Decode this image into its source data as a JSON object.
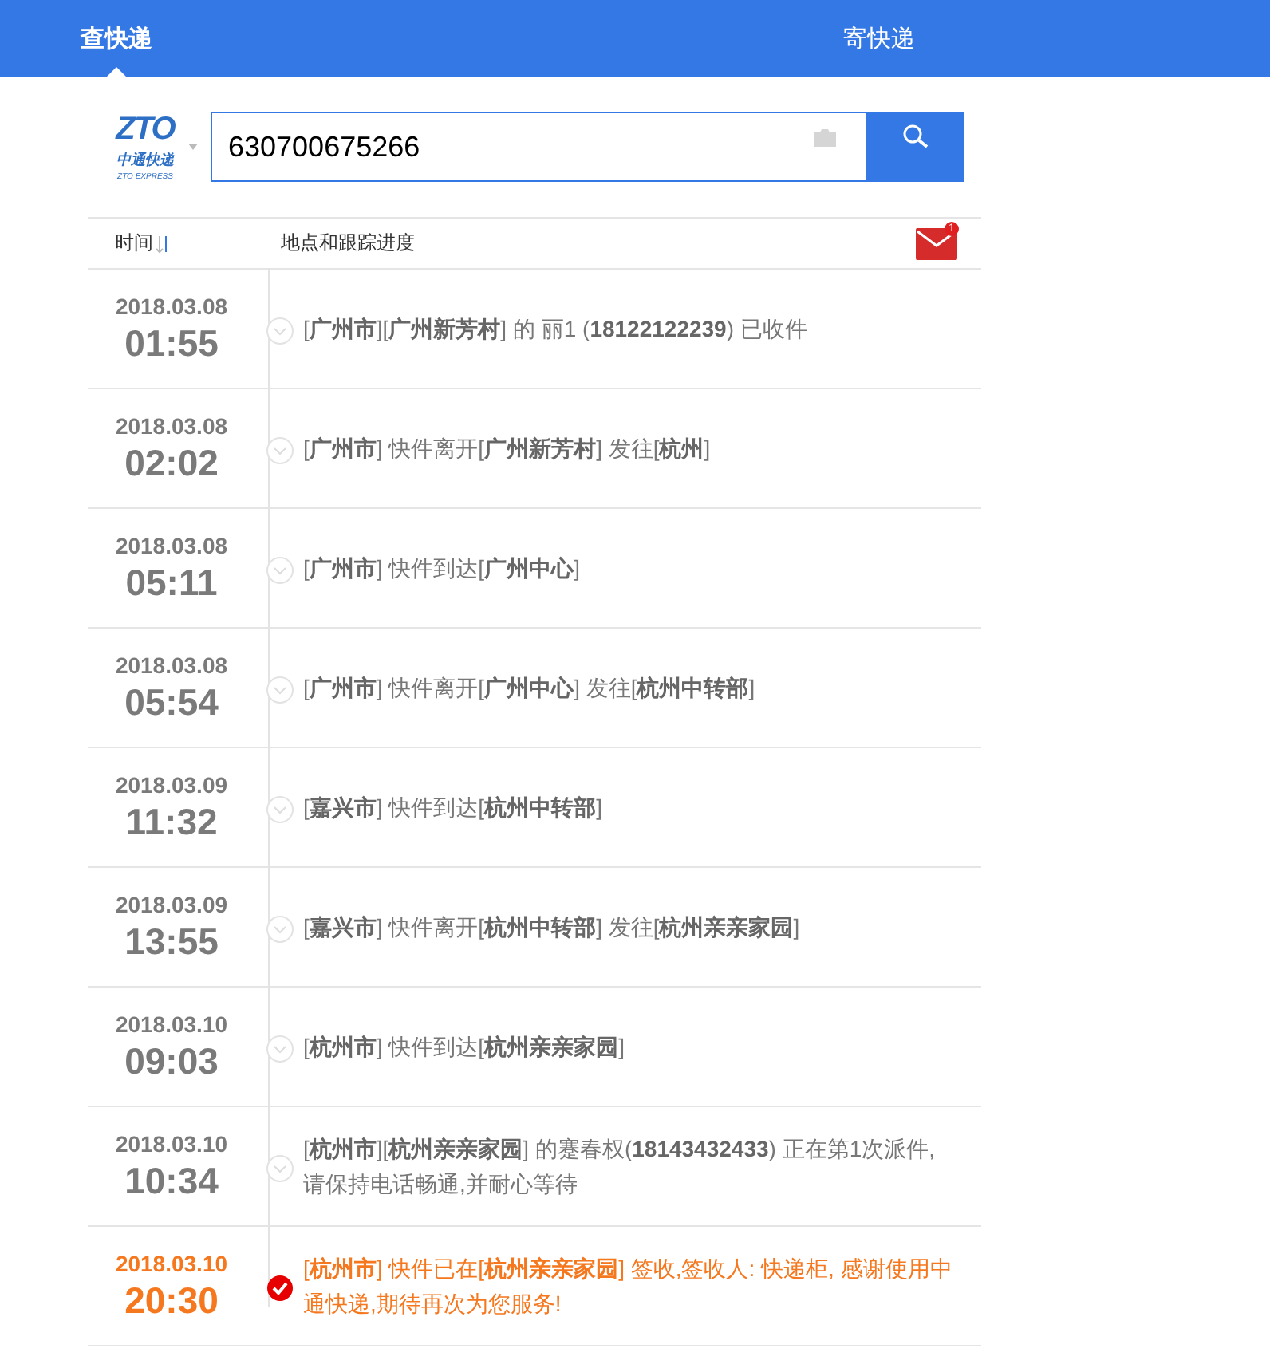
{
  "nav": {
    "tabs": [
      {
        "label": "查快递",
        "selected": true
      },
      {
        "label": "寄快递",
        "selected": false
      }
    ]
  },
  "search": {
    "logo": {
      "mark": "ZTO",
      "name": "中通快递",
      "tagline": "ZTO EXPRESS"
    },
    "value": "630700675266"
  },
  "header": {
    "time": "时间",
    "track": "地点和跟踪进度",
    "mail_badge": "1"
  },
  "events": [
    {
      "date": "2018.03.08",
      "time": "01:55",
      "text": "[**广州市**][**广州新芳村**] 的 丽1 (**18122122239**) 已收件",
      "delivered": false
    },
    {
      "date": "2018.03.08",
      "time": "02:02",
      "text": "[**广州市**] 快件离开[**广州新芳村**] 发往[**杭州**]",
      "delivered": false
    },
    {
      "date": "2018.03.08",
      "time": "05:11",
      "text": "[**广州市**] 快件到达[**广州中心**]",
      "delivered": false
    },
    {
      "date": "2018.03.08",
      "time": "05:54",
      "text": "[**广州市**] 快件离开[**广州中心**] 发往[**杭州中转部**]",
      "delivered": false
    },
    {
      "date": "2018.03.09",
      "time": "11:32",
      "text": "[**嘉兴市**] 快件到达[**杭州中转部**]",
      "delivered": false
    },
    {
      "date": "2018.03.09",
      "time": "13:55",
      "text": "[**嘉兴市**] 快件离开[**杭州中转部**] 发往[**杭州亲亲家园**]",
      "delivered": false
    },
    {
      "date": "2018.03.10",
      "time": "09:03",
      "text": "[**杭州市**] 快件到达[**杭州亲亲家园**]",
      "delivered": false
    },
    {
      "date": "2018.03.10",
      "time": "10:34",
      "text": "[**杭州市**][**杭州亲亲家园**] 的蹇春权(**18143432433**) 正在第1次派件, 请保持电话畅通,并耐心等待",
      "delivered": false
    },
    {
      "date": "2018.03.10",
      "time": "20:30",
      "text": "[**杭州市**] 快件已在[**杭州亲亲家园**] 签收,签收人: 快递柜, 感谢使用中通快递,期待再次为您服务!",
      "delivered": true
    }
  ]
}
